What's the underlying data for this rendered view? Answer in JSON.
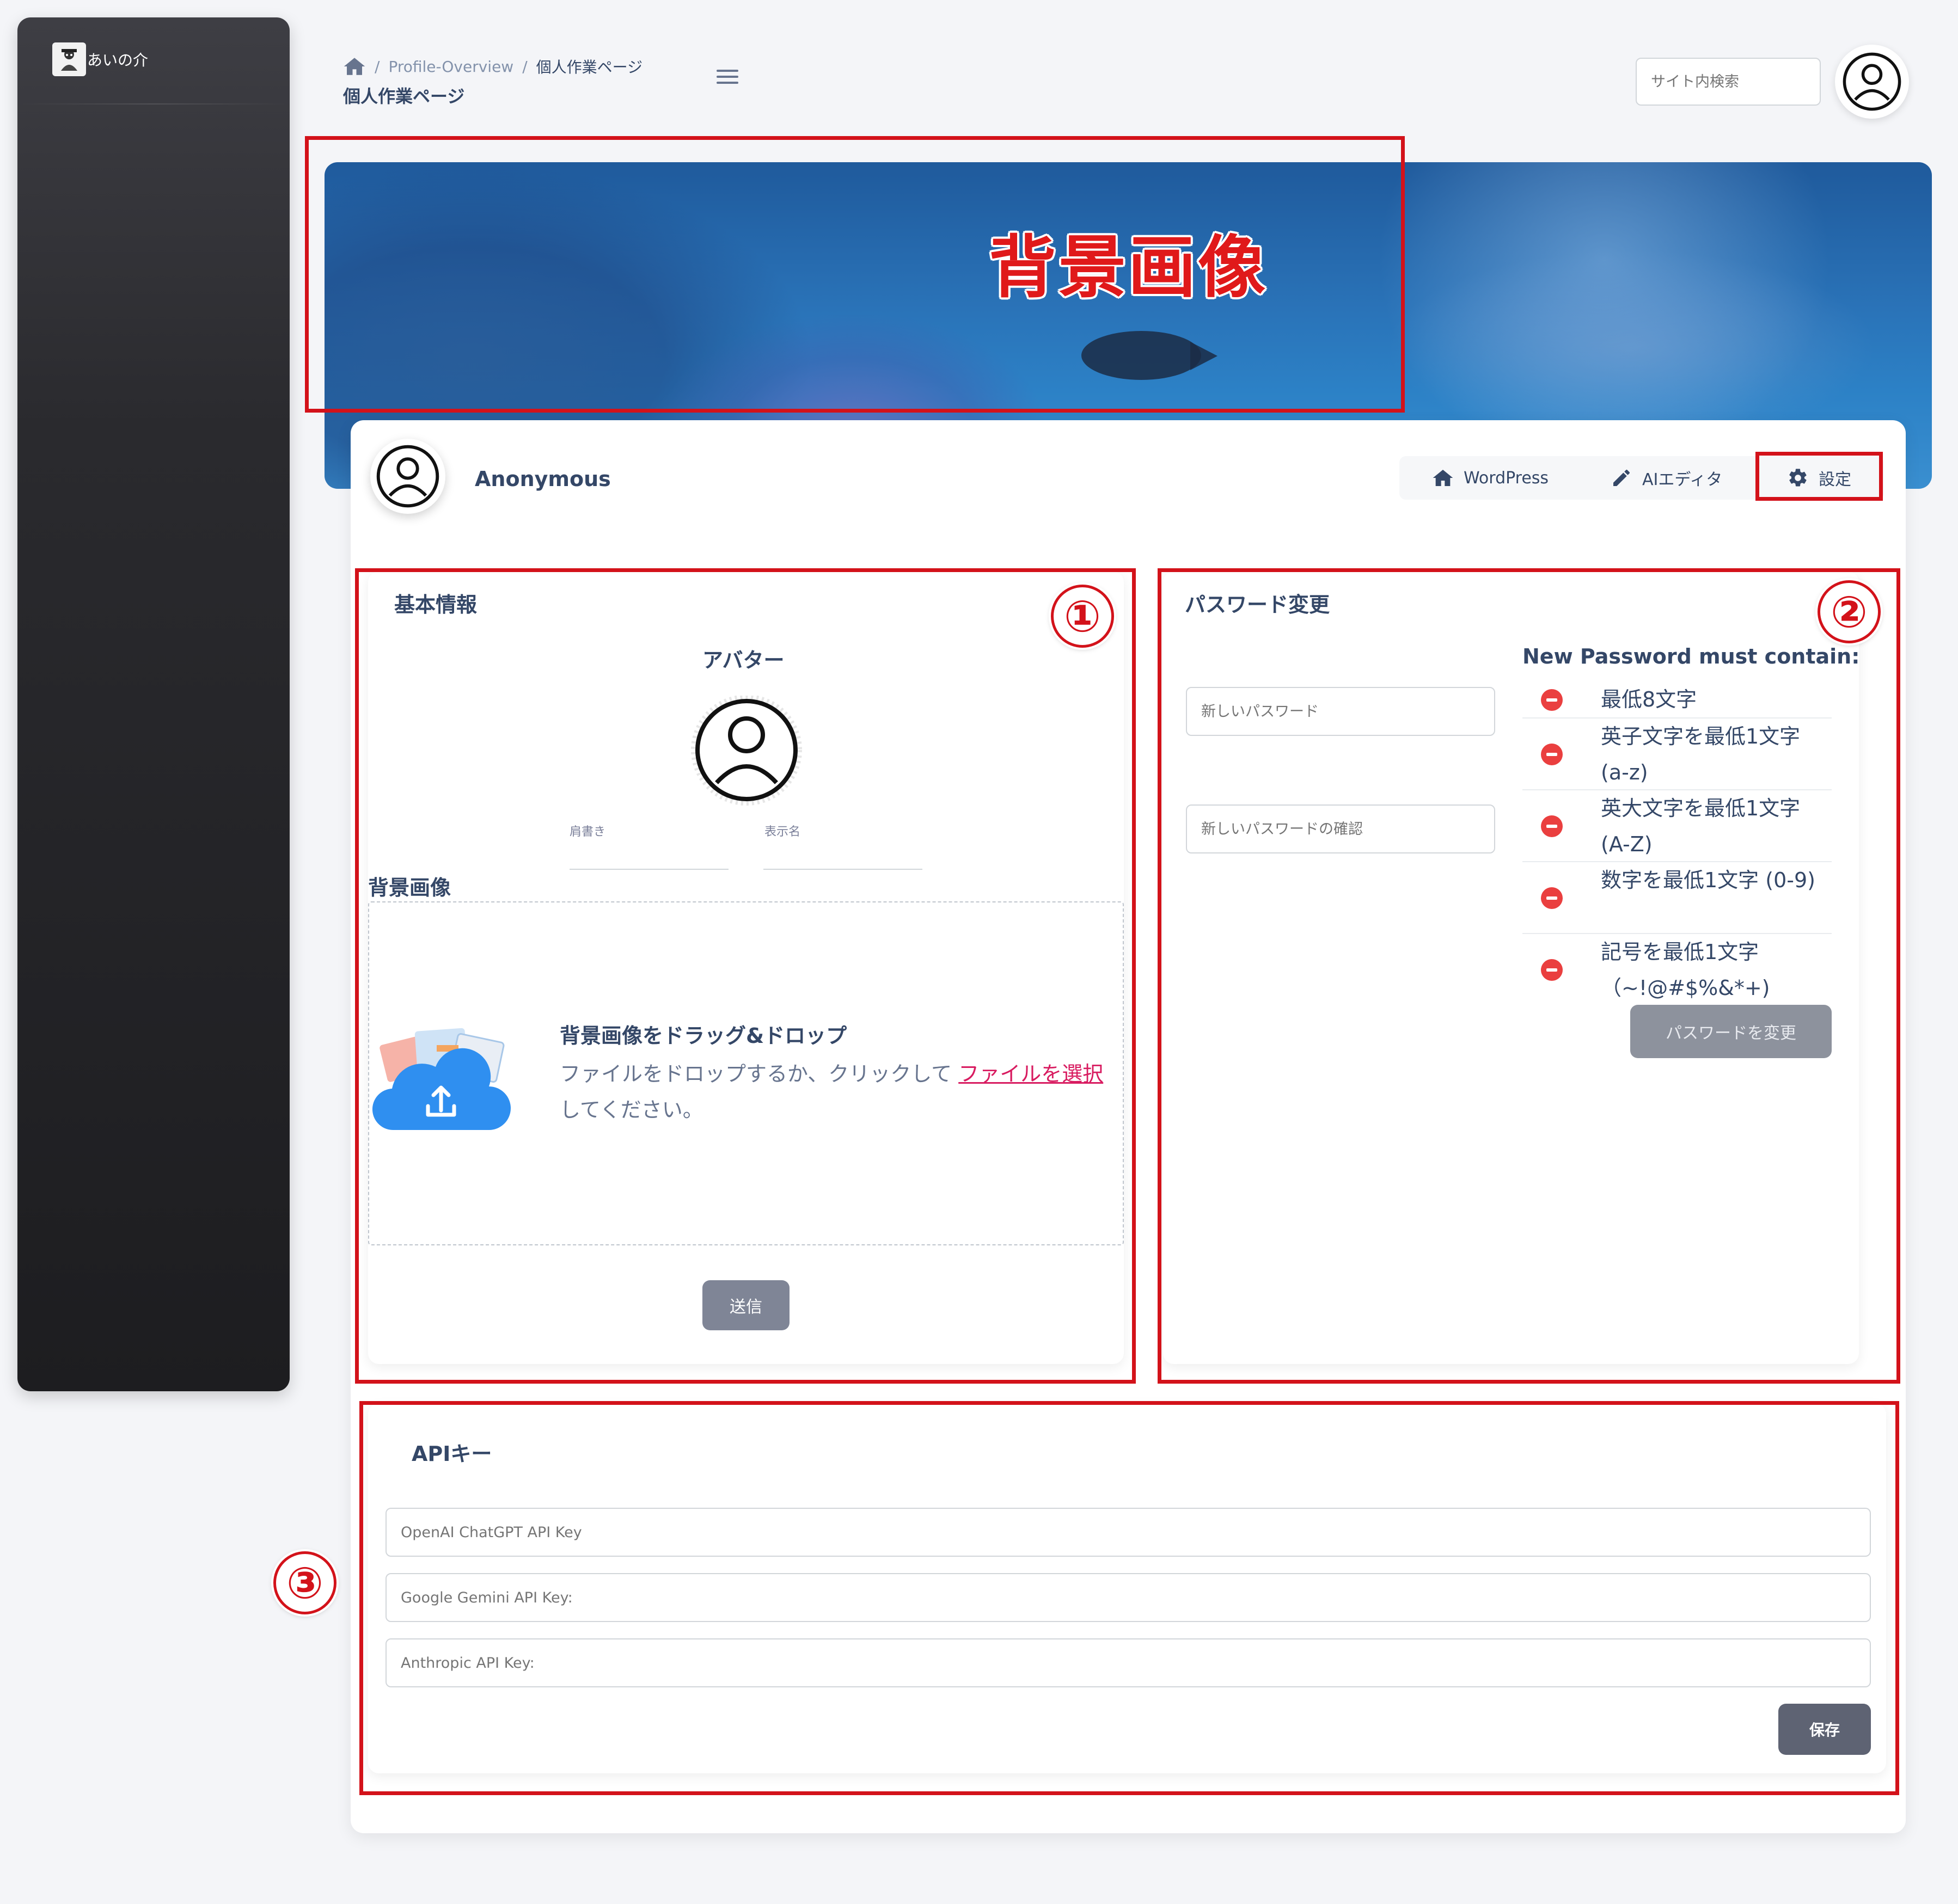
{
  "sidebar": {
    "brand_name": "あいの介"
  },
  "header": {
    "breadcrumb": [
      "Profile-Overview",
      "個人作業ページ"
    ],
    "page_title": "個人作業ページ",
    "search_placeholder": "サイト内検索"
  },
  "banner": {
    "annotation_title": "背景画像"
  },
  "profile": {
    "name": "Anonymous",
    "tabs": [
      {
        "label": "WordPress",
        "icon": "home-icon"
      },
      {
        "label": "AIエディタ",
        "icon": "pencil-icon"
      },
      {
        "label": "設定",
        "icon": "gear-icon"
      }
    ]
  },
  "basic_info": {
    "title": "基本情報",
    "avatar_label": "アバター",
    "title_field_label": "肩書き",
    "display_name_label": "表示名",
    "background_label": "背景画像",
    "dropzone": {
      "title": "背景画像をドラッグ&ドロップ",
      "text_before": "ファイルをドロップするか、クリックして ",
      "link": "ファイルを選択",
      "text_after": " してください。"
    },
    "submit_label": "送信"
  },
  "password": {
    "title": "パスワード変更",
    "new_placeholder": "新しいパスワード",
    "confirm_placeholder": "新しいパスワードの確認",
    "requirements_title": "New Password must contain:",
    "requirements": [
      "最低8文字",
      "英子文字を最低1文字 (a-z)",
      "英大文字を最低1文字 (A-Z)",
      "数字を最低1文字 (0-9)",
      "記号を最低1文字 （~!@#$%&*+)"
    ],
    "submit_label": "パスワードを変更"
  },
  "api_keys": {
    "title": "APIキー",
    "openai_placeholder": "OpenAI ChatGPT API Key",
    "gemini_placeholder": "Google Gemini API Key:",
    "anthropic_placeholder": "Anthropic API Key:",
    "save_label": "保存"
  },
  "annotations": {
    "one": "①",
    "two": "②",
    "three": "③"
  },
  "colors": {
    "annotation_red": "#d3121a",
    "primary_text": "#344767",
    "link_pink": "#d81b60",
    "requirement_icon": "#ea3f3f"
  }
}
